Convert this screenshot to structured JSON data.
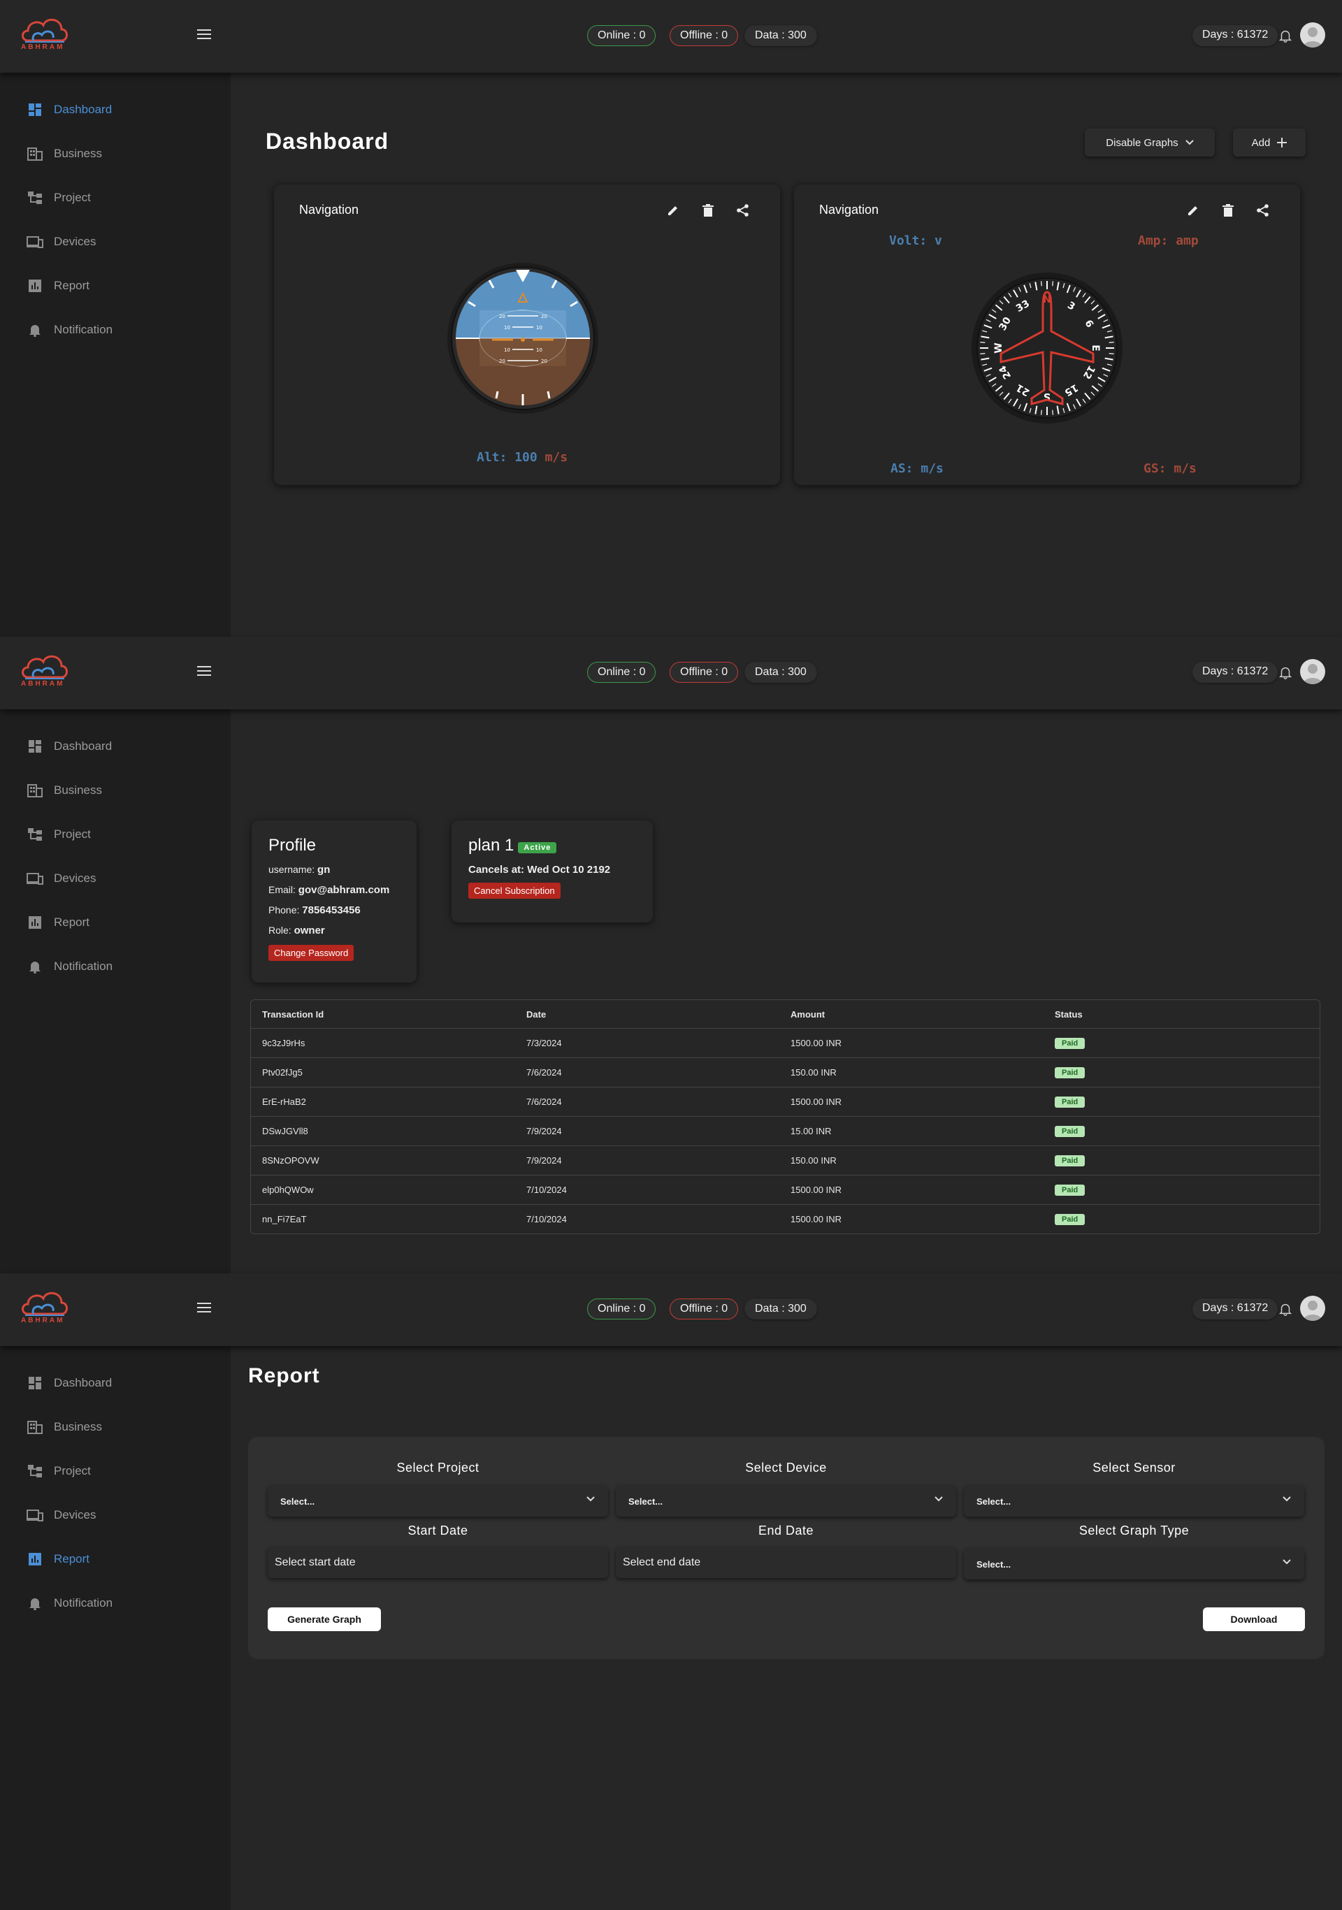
{
  "header": {
    "logo_text": "ABHRAM",
    "online": "Online  :  0",
    "offline": "Offline : 0",
    "data": "Data : 300",
    "days": "Days : 61372"
  },
  "sidebar": {
    "items": [
      {
        "label": "Dashboard",
        "icon": "dashboard-icon"
      },
      {
        "label": "Business",
        "icon": "business-icon"
      },
      {
        "label": "Project",
        "icon": "project-icon"
      },
      {
        "label": "Devices",
        "icon": "devices-icon"
      },
      {
        "label": "Report",
        "icon": "report-icon"
      },
      {
        "label": "Notification",
        "icon": "notification-icon"
      }
    ]
  },
  "colors": {
    "accent": "#4b8fd6",
    "online": "#3c9a4c",
    "offline": "#c33b35",
    "danger": "#b5261e",
    "paid_bg": "#b7e6b5"
  },
  "dashboard": {
    "title": "Dashboard",
    "disable_graphs": "Disable Graphs",
    "add": "Add",
    "card1": {
      "title": "Navigation",
      "alt_label": "Alt:",
      "alt_value": "100",
      "alt_unit": "m/s",
      "horizon_marks": [
        "20",
        "20",
        "10",
        "10",
        "10",
        "10",
        "20",
        "20"
      ]
    },
    "card2": {
      "title": "Navigation",
      "volt_label": "Volt:",
      "volt_unit": "v",
      "amp_label": "Amp:",
      "amp_unit": "amp",
      "as_label": "AS:",
      "as_unit": "m/s",
      "gs_label": "GS:",
      "gs_unit": "m/s",
      "compass_labels": [
        "N",
        "3",
        "6",
        "E",
        "12",
        "15",
        "S",
        "21",
        "24",
        "W",
        "30",
        "33"
      ]
    }
  },
  "profile": {
    "title": "Profile",
    "username_label": "username:",
    "username": "gn",
    "email_label": "Email:",
    "email": "gov@abhram.com",
    "phone_label": "Phone:",
    "phone": "7856453456",
    "role_label": "Role:",
    "role": "owner",
    "change_password": "Change Password"
  },
  "plan": {
    "title": "plan 1",
    "status": "Active",
    "cancels": "Cancels at: Wed Oct 10 2192",
    "cancel_button": "Cancel Subscription"
  },
  "transactions": {
    "headers": [
      "Transaction Id",
      "Date",
      "Amount",
      "Status"
    ],
    "rows": [
      [
        "9c3zJ9rHs",
        "7/3/2024",
        "1500.00 INR",
        "Paid"
      ],
      [
        "Ptv02fJg5",
        "7/6/2024",
        "150.00 INR",
        "Paid"
      ],
      [
        "ErE-rHaB2",
        "7/6/2024",
        "1500.00 INR",
        "Paid"
      ],
      [
        "DSwJGVll8",
        "7/9/2024",
        "15.00 INR",
        "Paid"
      ],
      [
        "8SNzOPOVW",
        "7/9/2024",
        "150.00 INR",
        "Paid"
      ],
      [
        "elp0hQWOw",
        "7/10/2024",
        "1500.00 INR",
        "Paid"
      ],
      [
        "nn_Fi7EaT",
        "7/10/2024",
        "1500.00 INR",
        "Paid"
      ]
    ]
  },
  "report": {
    "title": "Report",
    "select_project": "Select Project",
    "select_device": "Select Device",
    "select_sensor": "Select Sensor",
    "start_date": "Start Date",
    "end_date": "End Date",
    "select_graph_type": "Select Graph Type",
    "select_placeholder": "Select...",
    "start_placeholder": "Select start date",
    "end_placeholder": "Select end date",
    "generate": "Generate Graph",
    "download": "Download"
  }
}
